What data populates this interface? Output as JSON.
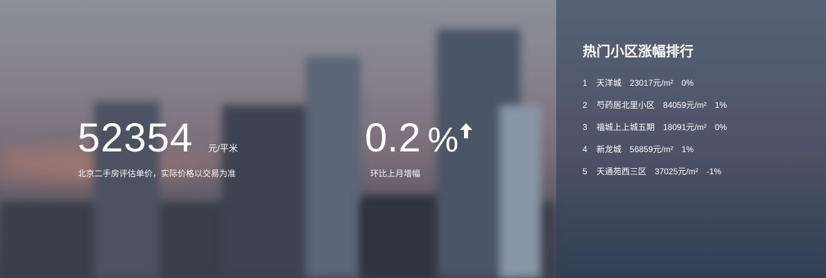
{
  "price": {
    "value": "52354",
    "unit": "元/平米",
    "description": "北京二手房评估单价，实际价格以交易为准"
  },
  "change": {
    "value": "0.2",
    "percent_sign": "%",
    "direction_icon": "arrow-up-icon",
    "description": "环比上月增幅"
  },
  "ranking": {
    "title": "热门小区涨幅排行",
    "items": [
      {
        "rank": "1",
        "name": "天洋城",
        "price": "23017元/m²",
        "change": "0%"
      },
      {
        "rank": "2",
        "name": "芍药居北里小区",
        "price": "84059元/m²",
        "change": "1%"
      },
      {
        "rank": "3",
        "name": "福城上上城五期",
        "price": "18091元/m²",
        "change": "0%"
      },
      {
        "rank": "4",
        "name": "新龙城",
        "price": "56859元/m²",
        "change": "1%"
      },
      {
        "rank": "5",
        "name": "天通苑西三区",
        "price": "37025元/m²",
        "change": "-1%"
      }
    ]
  }
}
